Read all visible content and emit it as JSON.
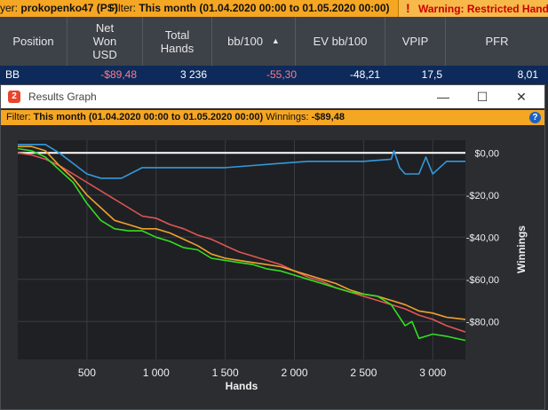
{
  "topbar": {
    "player_label": "yer:",
    "player": "prokopenko47 (PS)",
    "filter_label": "Filter:",
    "filter_value": "This month (01.04.2020 00:00 to 01.05.2020 00:00)",
    "warning": "Warning: Restricted Hands S"
  },
  "table": {
    "headers": [
      "Position",
      "Net Won USD",
      "Total Hands",
      "bb/100",
      "EV bb/100",
      "VPIP",
      "PFR"
    ],
    "row": [
      "BB",
      "-$89,48",
      "3 236",
      "-55,30",
      "-48,21",
      "17,5",
      "8,01"
    ]
  },
  "window": {
    "title": "Results Graph",
    "minimize": "—",
    "maximize": "☐",
    "close": "✕"
  },
  "filterbar": {
    "filter_label": "Filter:",
    "filter_value": "This month (01.04.2020 00:00 to 01.05.2020 00:00)",
    "winnings_label": "Winnings:",
    "winnings_value": "-$89,48",
    "help": "?"
  },
  "colors": {
    "warning_bg": "#f5a623",
    "row_selected": "#0d2a5a",
    "negative": "#ff7a86",
    "net_won": "#33dd22",
    "all_in_ev": "#f0a030",
    "showdown": "#e05555",
    "non_showdown": "#3399dd"
  },
  "chart_data": {
    "type": "line",
    "xlabel": "Hands",
    "ylabel": "Winnings",
    "x_ticks": [
      "500",
      "1 000",
      "1 500",
      "2 000",
      "2 500",
      "3 000"
    ],
    "y_ticks": [
      "$0,00",
      "-$20,00",
      "-$40,00",
      "-$60,00",
      "-$80,00"
    ],
    "xlim": [
      0,
      3236
    ],
    "ylim": [
      -98,
      6
    ],
    "grid": true,
    "series": [
      {
        "color": "#3399dd",
        "x": [
          0,
          200,
          300,
          400,
          500,
          600,
          750,
          900,
          1000,
          1100,
          1300,
          1500,
          1700,
          1900,
          2100,
          2300,
          2500,
          2700,
          2720,
          2760,
          2800,
          2900,
          2950,
          3000,
          3100,
          3236
        ],
        "y": [
          4,
          4,
          0,
          -5,
          -10,
          -12,
          -12,
          -7,
          -7,
          -7,
          -7,
          -7,
          -6,
          -5,
          -4,
          -4,
          -4,
          -3,
          1,
          -7,
          -10,
          -10,
          -2,
          -10,
          -4,
          -4
        ]
      },
      {
        "color": "#e05555",
        "x": [
          0,
          100,
          200,
          300,
          400,
          500,
          600,
          700,
          800,
          900,
          1000,
          1100,
          1200,
          1300,
          1400,
          1500,
          1600,
          1700,
          1800,
          1900,
          2000,
          2100,
          2200,
          2300,
          2400,
          2500,
          2600,
          2700,
          2800,
          2900,
          3000,
          3100,
          3236
        ],
        "y": [
          0,
          -1,
          -3,
          -6,
          -10,
          -14,
          -18,
          -22,
          -26,
          -30,
          -31,
          -34,
          -36,
          -39,
          -41,
          -44,
          -47,
          -49,
          -51,
          -53,
          -56,
          -59,
          -61,
          -64,
          -66,
          -68,
          -70,
          -72,
          -74,
          -77,
          -79,
          -82,
          -85
        ]
      },
      {
        "color": "#f0a030",
        "x": [
          0,
          100,
          200,
          300,
          400,
          500,
          600,
          700,
          800,
          900,
          1000,
          1100,
          1200,
          1300,
          1400,
          1500,
          1600,
          1700,
          1800,
          1900,
          2000,
          2100,
          2200,
          2300,
          2400,
          2500,
          2600,
          2700,
          2800,
          2900,
          3000,
          3100,
          3236
        ],
        "y": [
          3,
          3,
          1,
          -6,
          -12,
          -20,
          -26,
          -32,
          -34,
          -36,
          -36,
          -38,
          -41,
          -44,
          -48,
          -50,
          -51,
          -52,
          -53,
          -54,
          -56,
          -58,
          -60,
          -62,
          -65,
          -67,
          -68,
          -70,
          -72,
          -75,
          -76,
          -78,
          -79
        ]
      },
      {
        "color": "#33dd22",
        "x": [
          0,
          100,
          200,
          300,
          400,
          500,
          600,
          700,
          800,
          900,
          1000,
          1100,
          1200,
          1300,
          1400,
          1500,
          1600,
          1700,
          1800,
          1900,
          2000,
          2100,
          2200,
          2300,
          2400,
          2500,
          2600,
          2700,
          2800,
          2850,
          2900,
          3000,
          3100,
          3236
        ],
        "y": [
          2,
          1,
          -2,
          -8,
          -14,
          -24,
          -32,
          -36,
          -37,
          -37,
          -40,
          -42,
          -45,
          -46,
          -50,
          -51,
          -52,
          -53,
          -55,
          -56,
          -58,
          -60,
          -62,
          -64,
          -66,
          -67,
          -68,
          -72,
          -82,
          -80,
          -88,
          -86,
          -87,
          -89
        ]
      }
    ]
  }
}
